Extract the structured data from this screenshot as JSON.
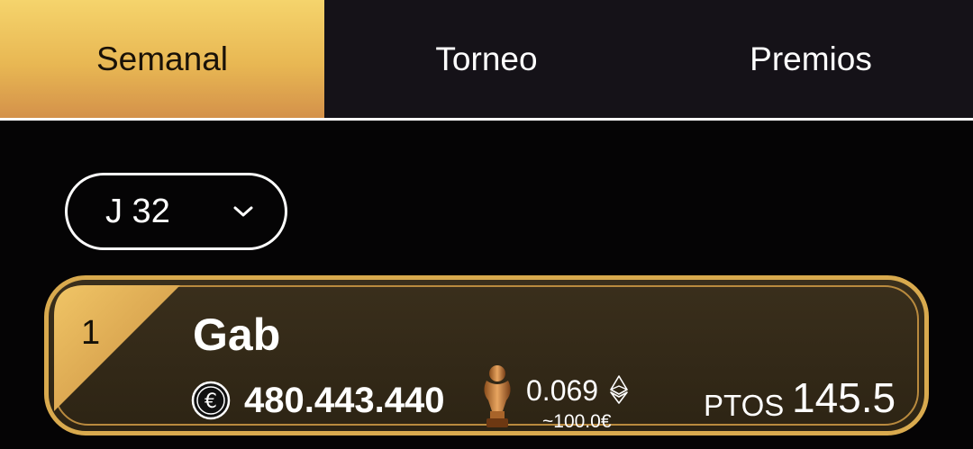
{
  "tabs": [
    {
      "label": "Semanal",
      "active": true
    },
    {
      "label": "Torneo",
      "active": false
    },
    {
      "label": "Premios",
      "active": false
    }
  ],
  "round_select": {
    "value": "J 32",
    "icon": "chevron-down-icon"
  },
  "leaderboard": [
    {
      "rank": "1",
      "name": "Gab",
      "coins": "480.443.440",
      "prize_eth": "0.069",
      "prize_eur": "~100.0€",
      "points_label": "PTOS",
      "points": "145.5"
    }
  ],
  "colors": {
    "accent_gold": "#e8b753",
    "card_border": "#d9aa4e",
    "card_bg": "#35291a",
    "tab_bar_bg": "#151218",
    "page_bg": "#050405"
  }
}
